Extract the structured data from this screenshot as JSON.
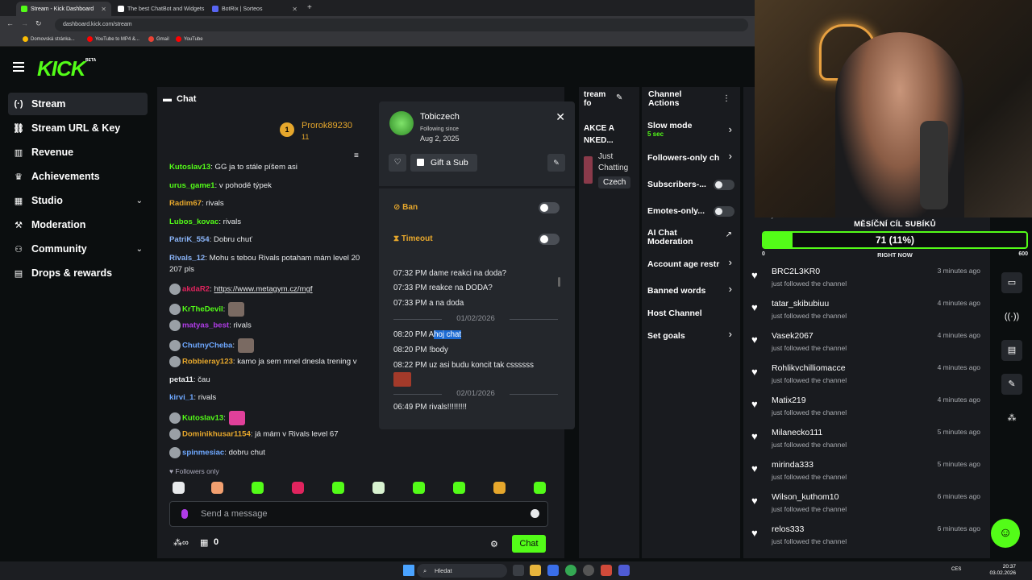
{
  "browser": {
    "tabs": [
      {
        "title": "Stream - Kick Dashboard",
        "color": "#53fc18"
      },
      {
        "title": "The best ChatBot and Widgets",
        "color": "#ffffff"
      },
      {
        "title": "BotRix | Sorteos",
        "color": "#5865f2"
      }
    ],
    "url": "dashboard.kick.com/stream",
    "bookmarks": [
      "Domovská stránka...",
      "YouTube to MP4 &...",
      "Gmail",
      "YouTube"
    ]
  },
  "brand": {
    "logo": "KICK",
    "beta": "BETA",
    "accent": "#53fc18"
  },
  "sidebar": {
    "items": [
      {
        "label": "Stream",
        "icon": "broadcast-icon",
        "glyph": "(·)"
      },
      {
        "label": "Stream URL & Key",
        "icon": "link-icon",
        "glyph": "🔗"
      },
      {
        "label": "Revenue",
        "icon": "chart-icon",
        "glyph": "▥"
      },
      {
        "label": "Achievements",
        "icon": "trophy-icon",
        "glyph": "🏆"
      },
      {
        "label": "Studio",
        "icon": "grid-icon",
        "glyph": "▦"
      },
      {
        "label": "Moderation",
        "icon": "hammer-icon",
        "glyph": "⚒"
      },
      {
        "label": "Community",
        "icon": "people-icon",
        "glyph": "👥"
      },
      {
        "label": "Drops & rewards",
        "icon": "gift-icon",
        "glyph": "▤"
      }
    ]
  },
  "chat": {
    "title": "Chat",
    "pinned_user": "Prorok89230",
    "pinned_rank": "1",
    "pinned_count": "11",
    "messages": [
      {
        "user": "Kutoslav13",
        "text": ": GG ja to stále píšem asi",
        "color": "#53fc18"
      },
      {
        "user": "urus_game1",
        "text": ": v pohodě týpek",
        "color": "#53fc18"
      },
      {
        "user": "Radim67",
        "text": ": rivals",
        "color": "#e6a72c"
      },
      {
        "user": "Lubos_kovac",
        "text": ": rivals",
        "color": "#53fc18"
      },
      {
        "user": "PatriK_554",
        "text": ": Dobru chuť",
        "color": "#8ab4f8"
      },
      {
        "user": "Rivals_12",
        "text": ": Mohu s tebou Rivals potaham mám level 20",
        "color": "#8ab4f8"
      },
      {
        "user": "",
        "text": "207 pls",
        "color": "#e8eaec"
      },
      {
        "user": "akdaR2",
        "text": "https://www.metagym.cz/mgf",
        "color": "#e0245e"
      },
      {
        "user": "KrTheDevil",
        "text": ":",
        "color": "#53fc18"
      },
      {
        "user": "matyas_best",
        "text": ": rivals",
        "color": "#b13ce8"
      },
      {
        "user": "ChutnyCheba",
        "text": ":",
        "color": "#6ea8ff"
      },
      {
        "user": "Robbieray123",
        "text": ": kamo ja sem mnel dnesla trening v",
        "color": "#e6a72c"
      },
      {
        "user": "peta11",
        "text": ": čau",
        "color": "#e8eaec"
      },
      {
        "user": "kirvi_1",
        "text": ": rivals",
        "color": "#6ea8ff"
      },
      {
        "user": "Kutoslav13",
        "text": ":",
        "color": "#53fc18"
      },
      {
        "user": "Dominikhusar1154",
        "text": ": já mám v Rivals level 67",
        "color": "#e6a72c"
      },
      {
        "user": "spinmesiac",
        "text": ": dobru chut",
        "color": "#6ea8ff"
      }
    ],
    "followers_only": "Followers only",
    "input_placeholder": "Send a message",
    "drops_count": "0",
    "send_label": "Chat"
  },
  "popover": {
    "username": "Tobiczech",
    "following_label": "Following since",
    "following_date": "Aug 2, 2025",
    "gift_label": "Gift a Sub",
    "ban_label": "Ban",
    "timeout_label": "Timeout",
    "history": [
      {
        "time": "07:32 PM",
        "text": "dame reakci na doda?"
      },
      {
        "time": "07:33 PM",
        "text": "reakce na DODA?"
      },
      {
        "time": "07:33 PM",
        "text": "a na doda"
      },
      {
        "date": "01/02/2026"
      },
      {
        "time": "08:20 PM",
        "pre": "A",
        "sel": "hoj chat",
        "text": ""
      },
      {
        "time": "08:20 PM",
        "text": "!body"
      },
      {
        "time": "08:22 PM",
        "text": "uz asi budu koncit tak cssssss"
      },
      {
        "date": "02/01/2026"
      },
      {
        "time": "06:49 PM",
        "text": "rivals!!!!!!!!!"
      }
    ]
  },
  "stream_info": {
    "header": "tream\nfo",
    "title": "AKCE A\nNKED...",
    "category": "Just\nChatting",
    "language": "Czech"
  },
  "channel_actions": {
    "title": "Channel\nActions",
    "items": [
      {
        "label": "Slow mode",
        "sub": "5 sec",
        "kind": "chevron"
      },
      {
        "label": "Followers-only ch",
        "kind": "chevron"
      },
      {
        "label": "Subscribers-...",
        "kind": "toggle"
      },
      {
        "label": "Emotes-only...",
        "kind": "toggle"
      },
      {
        "label": "AI Chat\nModeration",
        "kind": "external"
      },
      {
        "label": "Account age restr",
        "kind": "chevron"
      },
      {
        "label": "Banned words",
        "kind": "chevron"
      },
      {
        "label": "Host Channel",
        "kind": "none"
      },
      {
        "label": "Set goals",
        "kind": "chevron"
      }
    ]
  },
  "activity": {
    "items": [
      {
        "name": "BRC2L3KR0",
        "action": "just followed the channel",
        "time": "3 minutes ago"
      },
      {
        "name": "tatar_skibubiuu",
        "action": "just followed the channel",
        "time": "4 minutes ago"
      },
      {
        "name": "Vasek2067",
        "action": "just followed the channel",
        "time": "4 minutes ago"
      },
      {
        "name": "Rohlikvchilliomacce",
        "action": "just followed the channel",
        "time": "4 minutes ago"
      },
      {
        "name": "Matix219",
        "action": "just followed the channel",
        "time": "4 minutes ago"
      },
      {
        "name": "Milanecko111",
        "action": "just followed the channel",
        "time": "5 minutes ago"
      },
      {
        "name": "mirinda333",
        "action": "just followed the channel",
        "time": "5 minutes ago"
      },
      {
        "name": "Wilson_kuthom10",
        "action": "just followed the channel",
        "time": "6 minutes ago"
      },
      {
        "name": "relos333",
        "action": "just followed the channel",
        "time": "6 minutes ago"
      }
    ],
    "partial_top": "just followed the channel"
  },
  "goal": {
    "title": "MĚSÍČNÍ CÍL SUBÍKŮ",
    "text": "71 (11%)",
    "progress": 0.11,
    "min": "0",
    "max": "600",
    "sub": "RIGHT NOW"
  },
  "taskbar": {
    "search": "Hledat",
    "lang": "CES",
    "time": "20:37",
    "date": "03.02.2026"
  }
}
